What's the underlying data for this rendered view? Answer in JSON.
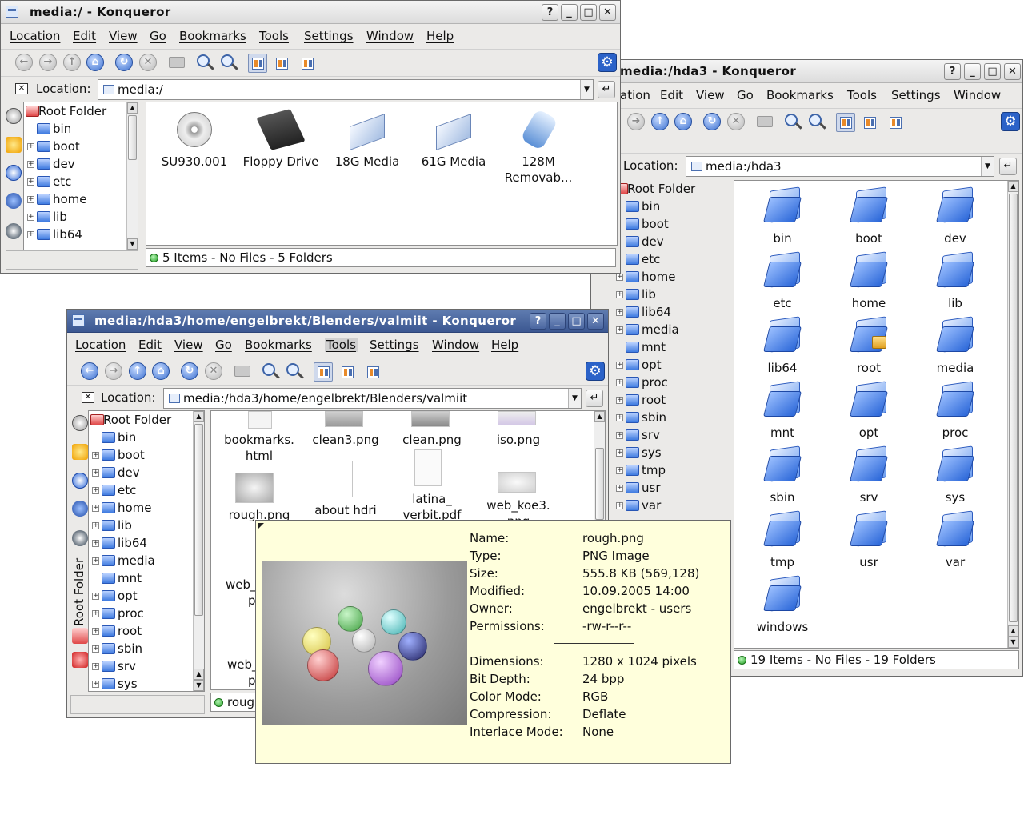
{
  "windows": {
    "media": {
      "title": "media:/ - Konqueror",
      "menu": [
        "Location",
        "Edit",
        "View",
        "Go",
        "Bookmarks",
        "Tools",
        "Settings",
        "Window",
        "Help"
      ],
      "location_label": "Location:",
      "location_value": "media:/",
      "tree_root": "Root Folder",
      "tree": [
        "bin",
        "boot",
        "dev",
        "etc",
        "home",
        "lib",
        "lib64"
      ],
      "icons": [
        "SU930.001",
        "Floppy Drive",
        "18G Media",
        "61G Media",
        "128M Removab..."
      ],
      "status": "5 Items - No Files - 5 Folders"
    },
    "hda3": {
      "title": "media:/hda3 - Konqueror",
      "menu": [
        "ation",
        "Edit",
        "View",
        "Go",
        "Bookmarks",
        "Tools",
        "Settings",
        "Window"
      ],
      "location_label": "Location:",
      "location_value": "media:/hda3",
      "tree_root": "Root Folder",
      "tree": [
        "bin",
        "boot",
        "dev",
        "etc",
        "home",
        "lib",
        "lib64",
        "media",
        "mnt",
        "opt",
        "proc",
        "root",
        "sbin",
        "srv",
        "sys",
        "tmp",
        "usr",
        "var"
      ],
      "icons": [
        "bin",
        "boot",
        "dev",
        "etc",
        "home",
        "lib",
        "lib64",
        "root",
        "media",
        "mnt",
        "opt",
        "proc",
        "sbin",
        "srv",
        "sys",
        "tmp",
        "usr",
        "var",
        "windows"
      ],
      "status": "19 Items - No Files - 19 Folders"
    },
    "valmiit": {
      "title": "media:/hda3/home/engelbrekt/Blenders/valmiit - Konqueror",
      "menu": [
        "Location",
        "Edit",
        "View",
        "Go",
        "Bookmarks",
        "Tools",
        "Settings",
        "Window",
        "Help"
      ],
      "location_label": "Location:",
      "location_value": "media:/hda3/home/engelbrekt/Blenders/valmiit",
      "tree_root": "Root Folder",
      "tree": [
        "bin",
        "boot",
        "dev",
        "etc",
        "home",
        "lib",
        "lib64",
        "media",
        "mnt",
        "opt",
        "proc",
        "root",
        "sbin",
        "srv",
        "sys"
      ],
      "vertical_tab": "Root Folder",
      "files": [
        "bookmarks.\nhtml",
        "clean3.png",
        "clean.png",
        "iso.png",
        "rough.png",
        "about hdri",
        "latina_\nverbit.pdf",
        "web_koe3.\npng"
      ],
      "partial_files": [
        "web_",
        "p",
        "web_",
        "p"
      ],
      "status": "roug"
    }
  },
  "tooltip": {
    "rows": [
      {
        "k": "Name:",
        "v": "rough.png"
      },
      {
        "k": "Type:",
        "v": "PNG Image"
      },
      {
        "k": "Size:",
        "v": "555.8 KB (569,128)"
      },
      {
        "k": "Modified:",
        "v": "10.09.2005 14:00"
      },
      {
        "k": "Owner:",
        "v": "engelbrekt - users"
      },
      {
        "k": "Permissions:",
        "v": "-rw-r--r--"
      }
    ],
    "rows2": [
      {
        "k": "Dimensions:",
        "v": "1280 x 1024 pixels"
      },
      {
        "k": "Bit Depth:",
        "v": "24 bpp"
      },
      {
        "k": "Color Mode:",
        "v": "RGB"
      },
      {
        "k": "Compression:",
        "v": "Deflate"
      },
      {
        "k": "Interlace Mode:",
        "v": "None"
      }
    ]
  },
  "colors": {
    "folder": "#3f7be0",
    "tooltip_bg": "#ffffdc",
    "active_title": "#3b5791",
    "window_bg": "#ebeae8"
  }
}
